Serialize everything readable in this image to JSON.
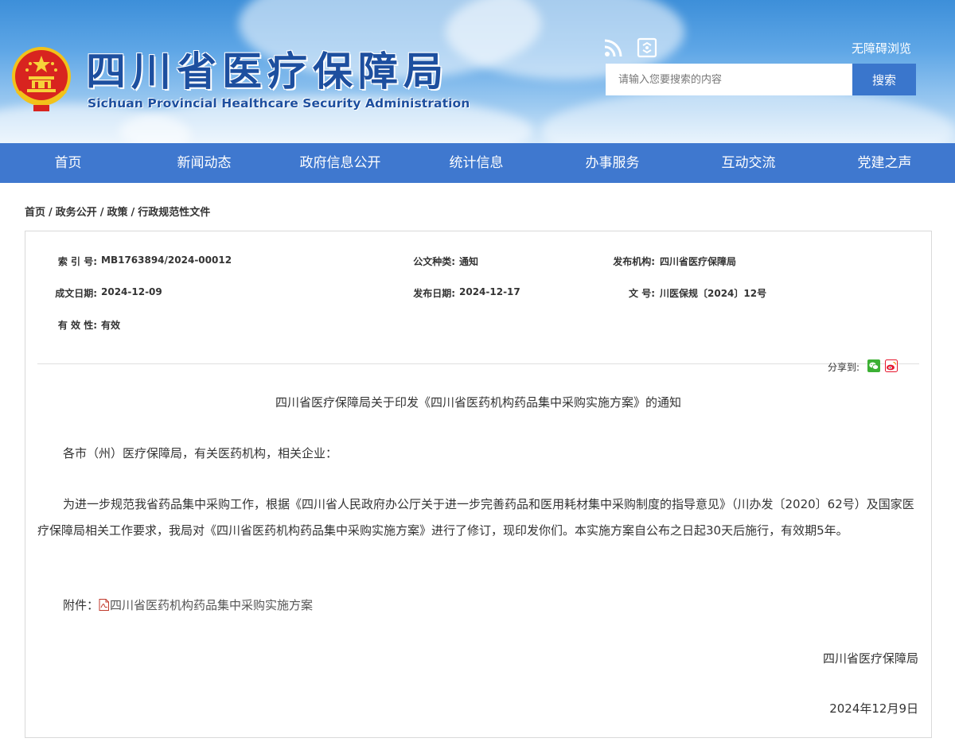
{
  "header": {
    "title_cn": "四川省医疗保障局",
    "title_en": "Sichuan Provincial Healthcare Security Administration",
    "accessibility_label": "无障碍浏览",
    "search_placeholder": "请输入您要搜索的内容",
    "search_button": "搜索",
    "icons": [
      "emblem-icon",
      "rss-icon",
      "mobile-icon"
    ]
  },
  "nav": {
    "items": [
      "首页",
      "新闻动态",
      "政府信息公开",
      "统计信息",
      "办事服务",
      "互动交流",
      "党建之声"
    ]
  },
  "breadcrumb": {
    "items": [
      "首页",
      "政务公开",
      "政策",
      "行政规范性文件"
    ],
    "separator": "/"
  },
  "meta": {
    "index_label": "索 引 号:",
    "index_value": "MB1763894/2024-00012",
    "doc_type_label": "公文种类:",
    "doc_type_value": "通知",
    "issuer_label": "发布机构:",
    "issuer_value": "四川省医疗保障局",
    "created_label": "成文日期:",
    "created_value": "2024-12-09",
    "published_label": "发布日期:",
    "published_value": "2024-12-17",
    "doc_no_label": "文 号:",
    "doc_no_value": "川医保规〔2024〕12号",
    "validity_label": "有 效 性:",
    "validity_value": "有效"
  },
  "share": {
    "label": "分享到:",
    "icons": [
      "wechat-icon",
      "weibo-icon"
    ]
  },
  "article": {
    "title": "四川省医疗保障局关于印发《四川省医药机构药品集中采购实施方案》的通知",
    "salutation": "各市（州）医疗保障局，有关医药机构，相关企业：",
    "body": "为进一步规范我省药品集中采购工作，根据《四川省人民政府办公厅关于进一步完善药品和医用耗材集中采购制度的指导意见》（川办发〔2020〕62号）及国家医疗保障局相关工作要求，我局对《四川省医药机构药品集中采购实施方案》进行了修订，现印发你们。本实施方案自公布之日起30天后施行，有效期5年。",
    "attachment_label": "附件：",
    "attachment_name": "四川省医药机构药品集中采购实施方案",
    "signature": "四川省医疗保障局",
    "date": "2024年12月9日"
  },
  "colors": {
    "nav_bg": "#3f78cf",
    "search_button_bg": "#3a76cc",
    "title_blue": "#1d4f9f",
    "wechat_green": "#3cb034",
    "weibo_red": "#e6162d"
  }
}
